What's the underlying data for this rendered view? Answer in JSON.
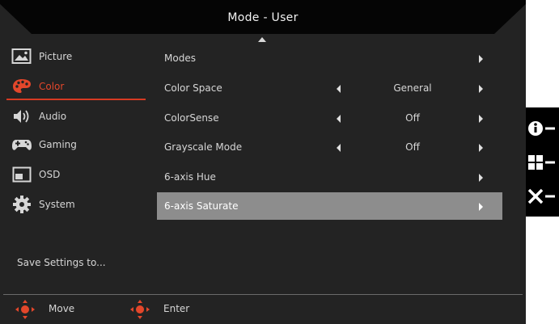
{
  "window": {
    "title": "Mode - User"
  },
  "sidebar": {
    "items": [
      {
        "label": "Picture",
        "icon": "picture-icon",
        "active": false
      },
      {
        "label": "Color",
        "icon": "palette-icon",
        "active": true
      },
      {
        "label": "Audio",
        "icon": "speaker-icon",
        "active": false
      },
      {
        "label": "Gaming",
        "icon": "gamepad-icon",
        "active": false
      },
      {
        "label": "OSD",
        "icon": "osd-window-icon",
        "active": false
      },
      {
        "label": "System",
        "icon": "gear-icon",
        "active": false
      }
    ],
    "save_label": "Save Settings to..."
  },
  "settings": {
    "rows": [
      {
        "label": "Modes",
        "value": "",
        "has_left_arrow": false,
        "selected": false
      },
      {
        "label": "Color Space",
        "value": "General",
        "has_left_arrow": true,
        "selected": false
      },
      {
        "label": "ColorSense",
        "value": "Off",
        "has_left_arrow": true,
        "selected": false
      },
      {
        "label": "Grayscale Mode",
        "value": "Off",
        "has_left_arrow": true,
        "selected": false
      },
      {
        "label": "6-axis Hue",
        "value": "",
        "has_left_arrow": false,
        "selected": false
      },
      {
        "label": "6-axis Saturate",
        "value": "",
        "has_left_arrow": false,
        "selected": true
      }
    ]
  },
  "footer": {
    "move_label": "Move",
    "enter_label": "Enter"
  },
  "hotkeys": [
    {
      "icon": "info-icon"
    },
    {
      "icon": "grid-icon"
    },
    {
      "icon": "close-icon"
    }
  ],
  "colors": {
    "accent": "#e3472b",
    "panel_bg": "#232323",
    "selected_row": "#8d8d8d",
    "hotkey_bg": "#000000"
  }
}
